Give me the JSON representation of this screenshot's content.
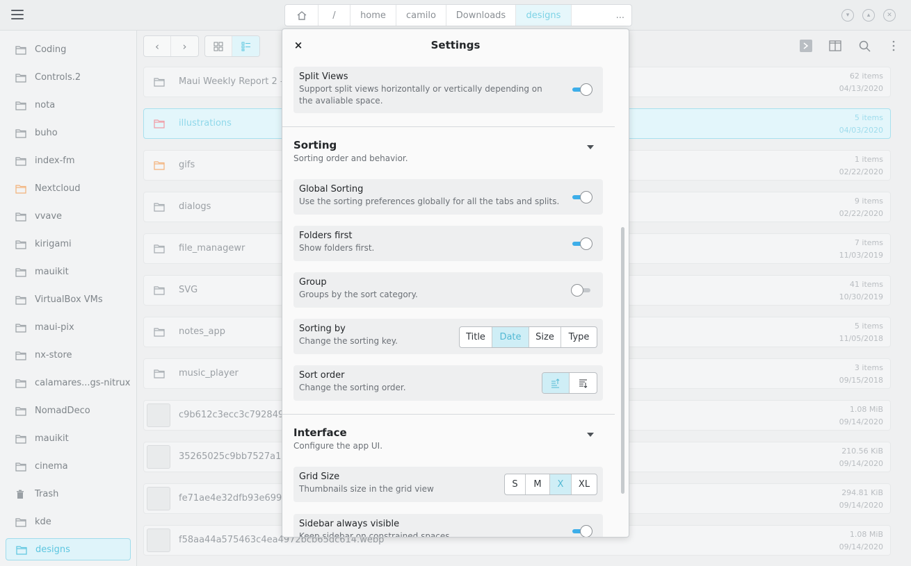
{
  "pathbar": {
    "crumbs": [
      "/",
      "home",
      "camilo",
      "Downloads",
      "designs"
    ],
    "overflow": "..."
  },
  "sidebar": {
    "items": [
      {
        "label": "Coding"
      },
      {
        "label": "Controls.2"
      },
      {
        "label": "nota"
      },
      {
        "label": "buho"
      },
      {
        "label": "index-fm"
      },
      {
        "label": "Nextcloud"
      },
      {
        "label": "vvave"
      },
      {
        "label": "kirigami"
      },
      {
        "label": "mauikit"
      },
      {
        "label": "VirtualBox VMs"
      },
      {
        "label": "maui-pix"
      },
      {
        "label": "nx-store"
      },
      {
        "label": "calamares...gs-nitrux"
      },
      {
        "label": "NomadDeco"
      },
      {
        "label": "mauikit"
      },
      {
        "label": "cinema"
      },
      {
        "label": "Trash"
      },
      {
        "label": "kde"
      },
      {
        "label": "designs"
      }
    ]
  },
  "files": [
    {
      "name": "Maui Weekly Report 2 —",
      "count": "62 items",
      "date": "04/13/2020"
    },
    {
      "name": "illustrations",
      "count": "5 items",
      "date": "04/03/2020"
    },
    {
      "name": "gifs",
      "count": "1 items",
      "date": "02/22/2020"
    },
    {
      "name": "dialogs",
      "count": "9 items",
      "date": "02/22/2020"
    },
    {
      "name": "file_managewr",
      "count": "7 items",
      "date": "11/03/2019"
    },
    {
      "name": "SVG",
      "count": "41 items",
      "date": "10/30/2019"
    },
    {
      "name": "notes_app",
      "count": "5 items",
      "date": "11/05/2018"
    },
    {
      "name": "music_player",
      "count": "3 items",
      "date": "09/15/2018"
    },
    {
      "name": "c9b612c3ecc3c79284978",
      "count": "1.08 MiB",
      "date": "09/14/2020"
    },
    {
      "name": "35265025c9bb7527a118",
      "count": "210.56 KiB",
      "date": "09/14/2020"
    },
    {
      "name": "fe71ae4e32dfb93e6995f",
      "count": "294.81 KiB",
      "date": "09/14/2020"
    },
    {
      "name": "f58aa44a575463c4ea4972bcb65dc614.webp",
      "count": "1.08 MiB",
      "date": "09/14/2020"
    }
  ],
  "dialog": {
    "title": "Settings",
    "close_label": "×",
    "split_views": {
      "title": "Split Views",
      "desc": "Support split views horizontally or vertically depending on the avaliable space."
    },
    "sorting": {
      "title": "Sorting",
      "desc": "Sorting order and behavior.",
      "global_sorting": {
        "title": "Global Sorting",
        "desc": "Use the sorting preferences globally for all the tabs and splits."
      },
      "folders_first": {
        "title": "Folders first",
        "desc": "Show folders first."
      },
      "group": {
        "title": "Group",
        "desc": "Groups by the sort category."
      },
      "sorting_by": {
        "title": "Sorting by",
        "desc": "Change the sorting key.",
        "options": [
          "Title",
          "Date",
          "Size",
          "Type"
        ],
        "selected": "Date"
      },
      "sort_order": {
        "title": "Sort order",
        "desc": "Change the sorting order."
      }
    },
    "interface": {
      "title": "Interface",
      "desc": "Configure the app UI.",
      "grid_size": {
        "title": "Grid Size",
        "desc": "Thumbnails size in the grid view",
        "options": [
          "S",
          "M",
          "X",
          "XL"
        ],
        "selected": "X"
      },
      "sidebar_visible": {
        "title": "Sidebar always visible",
        "desc": "Keep sidebar on constrained spaces"
      }
    }
  },
  "colors": {
    "accent": "#3daee9",
    "selection": "#e3f6fb",
    "orange_folder": "#f3b27a"
  }
}
